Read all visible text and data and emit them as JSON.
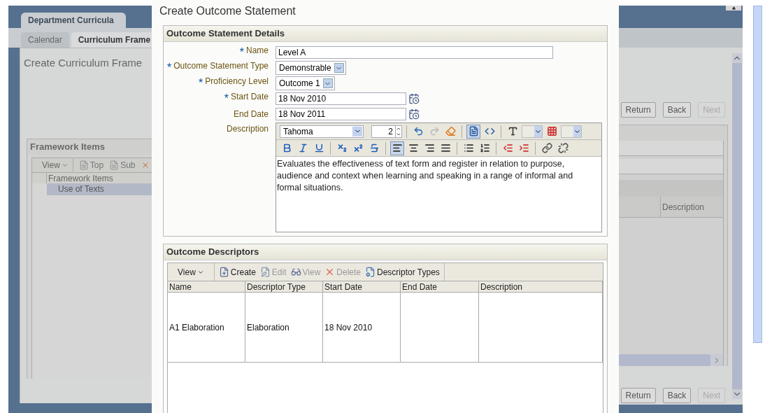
{
  "background": {
    "tabs": [
      {
        "label": "Department Curricula",
        "selected": true
      }
    ],
    "subtabs": [
      {
        "label": "Calendar",
        "selected": false
      },
      {
        "label": "Curriculum Frame",
        "selected": true
      }
    ],
    "page_title": "Create Curriculum Frame",
    "top_buttons": [
      {
        "label": "Return",
        "disabled": false
      },
      {
        "label": "Back",
        "disabled": false
      },
      {
        "label": "Next",
        "disabled": true
      }
    ],
    "framework_panel": {
      "title": "Framework Items",
      "toolbar": [
        {
          "kind": "menu",
          "label": "View"
        },
        {
          "kind": "action",
          "label": "Top"
        },
        {
          "kind": "action",
          "label": "Sub"
        }
      ],
      "column": "Framework Items",
      "rows": [
        {
          "label": "Use of Texts",
          "selected": true
        }
      ],
      "right_column": "Description"
    },
    "bottom_buttons": [
      {
        "label": "Return",
        "disabled": false
      },
      {
        "label": "Back",
        "disabled": false
      },
      {
        "label": "Next",
        "disabled": true
      }
    ]
  },
  "dialog": {
    "title": "Create Outcome Statement",
    "details": {
      "title": "Outcome Statement Details",
      "fields": [
        {
          "kind": "text",
          "label": "Name",
          "required_mark": "*",
          "value": "Level A"
        },
        {
          "kind": "select",
          "label": "Outcome Statement Type",
          "required_mark": "*",
          "value": "Demonstrable"
        },
        {
          "kind": "select",
          "label": "Proficiency Level",
          "required_mark": "*",
          "value": "Outcome 1"
        },
        {
          "kind": "date",
          "label": "Start Date",
          "required_mark": "*",
          "value": "18 Nov 2010"
        },
        {
          "kind": "date",
          "label": "End Date",
          "value": "18 Nov 2011"
        }
      ],
      "description": {
        "label": "Description",
        "font": "Tahoma",
        "size": "2",
        "toggles": [
          {
            "kind": "rich_text",
            "selected": true
          },
          {
            "kind": "source",
            "selected": false
          },
          {
            "kind": "align_left",
            "selected": true
          },
          {
            "kind": "align_center",
            "selected": false
          },
          {
            "kind": "align_right",
            "selected": false
          },
          {
            "kind": "align_justify",
            "selected": false
          }
        ],
        "text": "Evaluates the effectiveness of text form and register in relation to purpose, audience and context when learning and speaking in a range of informal and formal situations."
      }
    },
    "descriptors": {
      "title": "Outcome Descriptors",
      "toolbar": [
        {
          "kind": "menu",
          "label": "View",
          "disabled": false
        },
        {
          "kind": "create",
          "label": "Create",
          "disabled": false
        },
        {
          "kind": "edit",
          "label": "Edit",
          "disabled": true
        },
        {
          "kind": "view",
          "label": "View",
          "disabled": true
        },
        {
          "kind": "delete",
          "label": "Delete",
          "disabled": true
        },
        {
          "kind": "types",
          "label": "Descriptor Types",
          "disabled": false
        }
      ],
      "columns": [
        "Name",
        "Descriptor Type",
        "Start Date",
        "End Date",
        "Description"
      ],
      "rows": [
        [
          "A1 Elaboration",
          "Elaboration",
          "18 Nov 2010",
          "",
          ""
        ]
      ]
    }
  }
}
